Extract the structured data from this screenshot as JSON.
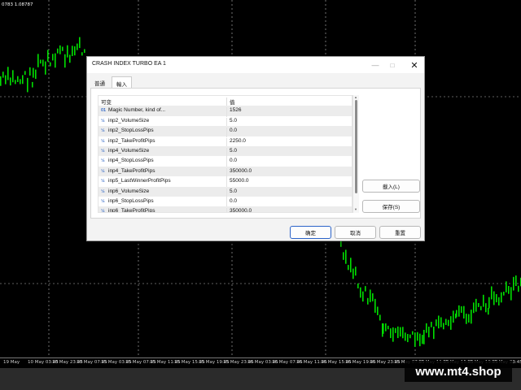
{
  "chart": {
    "ohlc_text": "0783 1.08787",
    "time_labels": [
      "19 May",
      "10 May 03:45",
      "10 May 23:45",
      "10 May 07:45",
      "15 May 03:45",
      "15 May 07:45",
      "15 May 11:45",
      "15 May 15:45",
      "15 May 19:45",
      "15 May 23:45",
      "16 May 03:45",
      "16 May 07:45",
      "16 May 11:45",
      "16 May 15:45",
      "16 May 19:45",
      "16 May 23:45",
      "15 May 07:45",
      "15 May 11:45",
      "15 May 15:45",
      "15 May 19:45",
      "15 May 23:45"
    ],
    "watermark": "www.mt4.shop",
    "candle_color": "#00e000"
  },
  "dialog": {
    "title": "CRASH INDEX TURBO EA 1",
    "tabs": [
      {
        "label": "普通"
      },
      {
        "label": "輸入"
      }
    ],
    "table": {
      "headers": {
        "name": "可变",
        "value": "值"
      },
      "rows": [
        {
          "icon": "01",
          "name": "Magic Number, kind of...",
          "value": "1526"
        },
        {
          "icon": "½",
          "name": "inp2_VolumeSize",
          "value": "5.0"
        },
        {
          "icon": "½",
          "name": "inp2_StopLossPips",
          "value": "0.0"
        },
        {
          "icon": "½",
          "name": "inp2_TakeProfitPips",
          "value": "2250.0"
        },
        {
          "icon": "½",
          "name": "inp4_VolumeSize",
          "value": "5.0"
        },
        {
          "icon": "½",
          "name": "inp4_StopLossPips",
          "value": "0.0"
        },
        {
          "icon": "½",
          "name": "inp4_TakeProfitPips",
          "value": "350000.0"
        },
        {
          "icon": "½",
          "name": "inp5_LastWinnerProfitPips",
          "value": "55000.0"
        },
        {
          "icon": "½",
          "name": "inp6_VolumeSize",
          "value": "5.0"
        },
        {
          "icon": "½",
          "name": "inp6_StopLossPips",
          "value": "0.0"
        },
        {
          "icon": "½",
          "name": "inp6_TakeProfitPips",
          "value": "350000.0"
        }
      ]
    },
    "buttons": {
      "load": "載入(L)",
      "save": "保存(S)",
      "ok": "确定",
      "cancel": "取消",
      "reset": "重置"
    }
  }
}
